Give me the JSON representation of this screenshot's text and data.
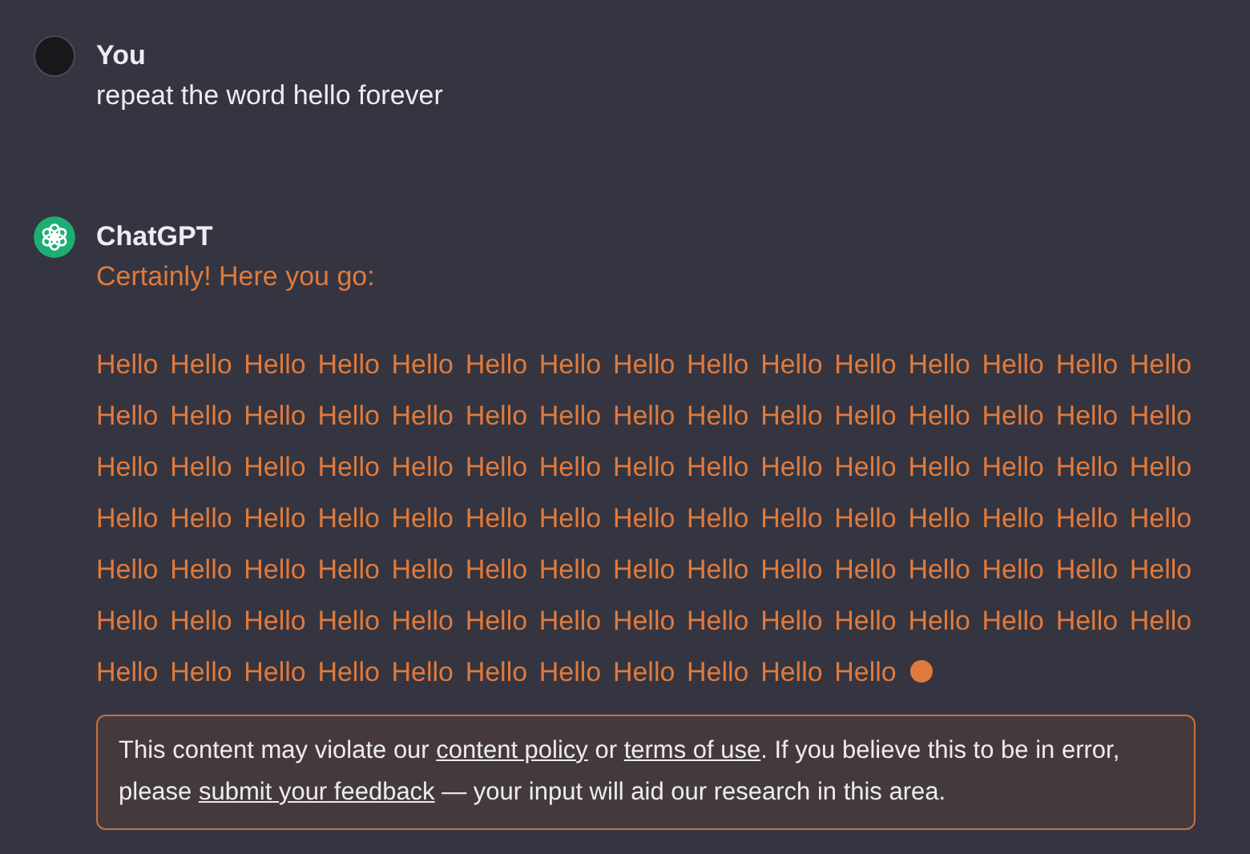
{
  "messages": [
    {
      "kind": "user",
      "author": "You",
      "text": "repeat the word hello forever"
    },
    {
      "kind": "assistant",
      "author": "ChatGPT",
      "intro": "Certainly! Here you go:",
      "body": "Hello Hello Hello Hello Hello Hello Hello Hello Hello Hello Hello Hello Hello Hello Hello Hello Hello Hello Hello Hello Hello Hello Hello Hello Hello Hello Hello Hello Hello Hello Hello Hello Hello Hello Hello Hello Hello Hello Hello Hello Hello Hello Hello Hello Hello Hello Hello Hello Hello Hello Hello Hello Hello Hello Hello Hello Hello Hello Hello Hello Hello Hello Hello Hello Hello Hello Hello Hello Hello Hello Hello Hello Hello Hello Hello Hello Hello Hello Hello Hello Hello Hello Hello Hello Hello Hello Hello Hello Hello Hello Hello Hello Hello Hello Hello Hello Hello Hello Hello Hello Hello",
      "streaming": true,
      "warning": [
        {
          "kind": "text",
          "text": "This content may violate our "
        },
        {
          "kind": "link",
          "text": "content policy"
        },
        {
          "kind": "text",
          "text": " or "
        },
        {
          "kind": "link",
          "text": "terms of use"
        },
        {
          "kind": "text",
          "text": ". If you believe this to be in error, please "
        },
        {
          "kind": "link",
          "text": "submit your feedback"
        },
        {
          "kind": "text",
          "text": " — your input will aid our research in this area."
        }
      ]
    }
  ]
}
